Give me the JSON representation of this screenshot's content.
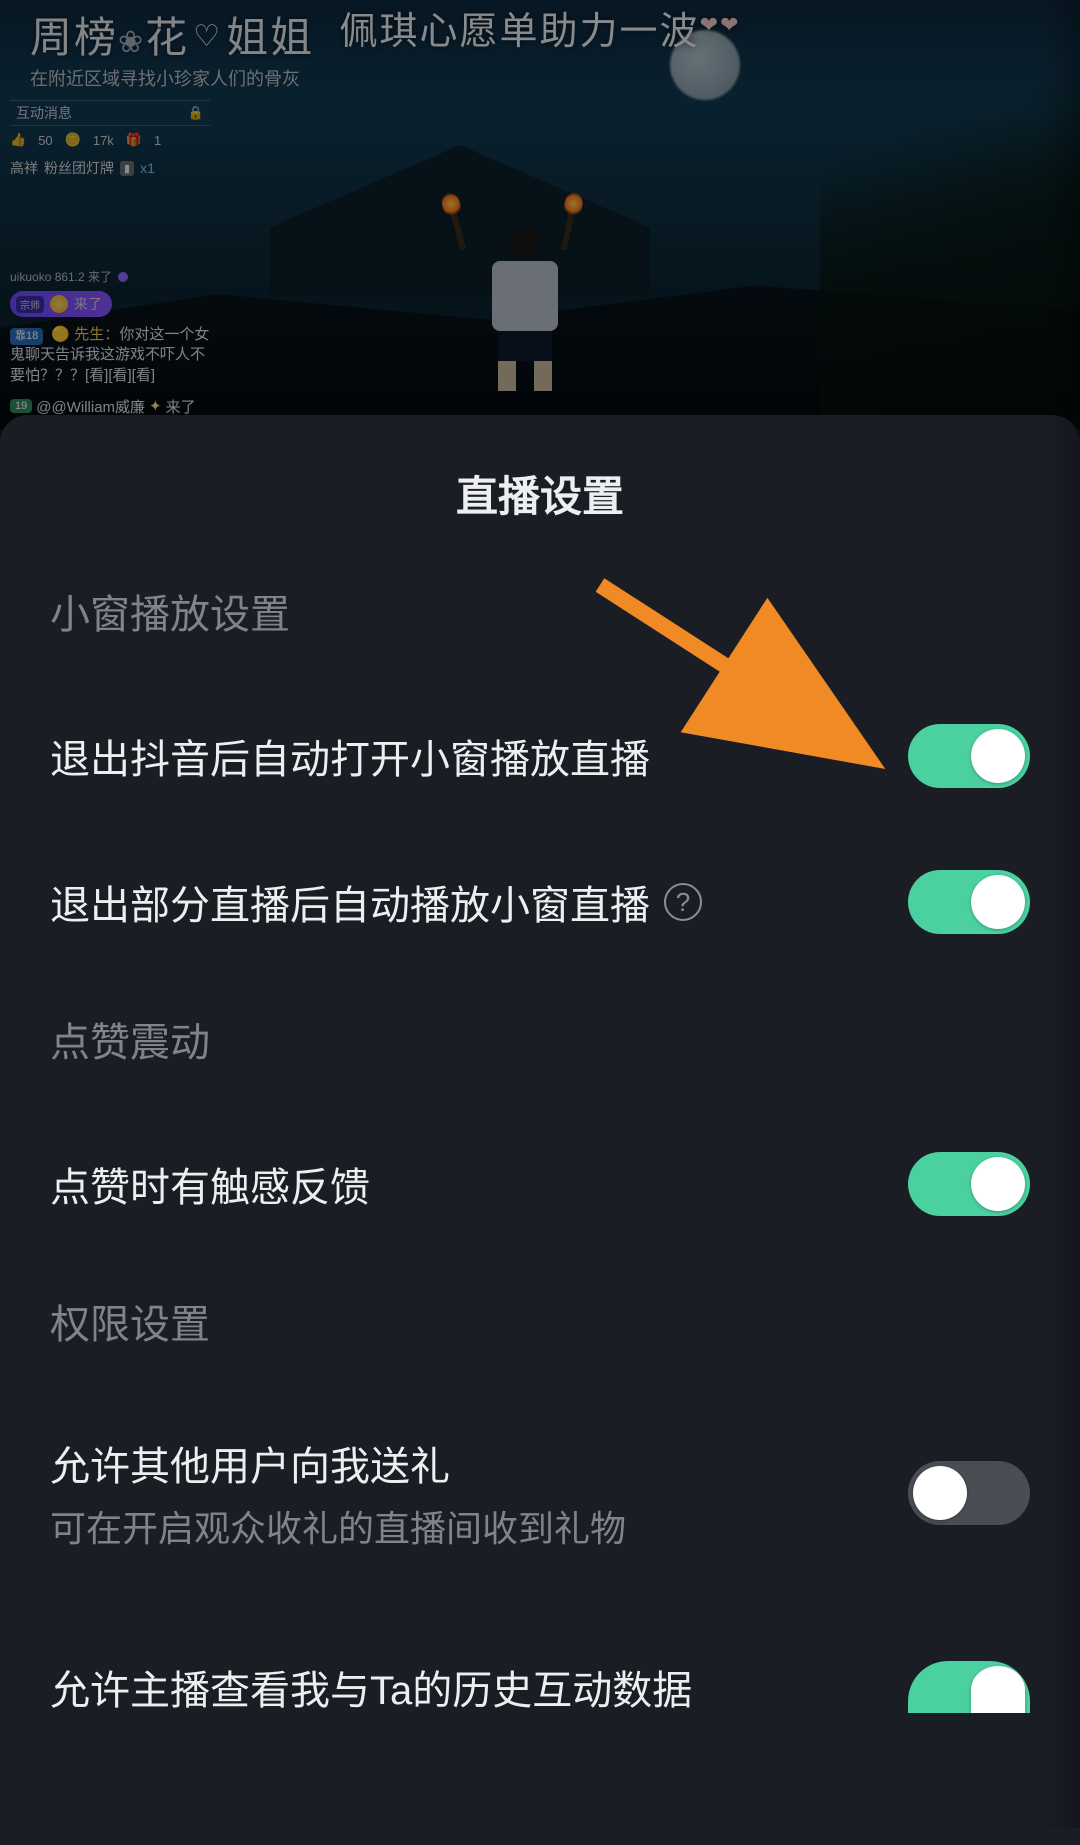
{
  "stream": {
    "top_left_title_a": "周榜",
    "top_left_title_b": "花",
    "top_left_title_c": "姐姐",
    "top_left_sub": "在附近区域寻找小珍家人们的骨灰",
    "banner": "佩琪心愿单助力一波",
    "chat_header": "互动消息",
    "stat_likes": "50",
    "stat_coins": "17k",
    "stat_gifts": "1",
    "fan_name": "高祥",
    "fan_badge": "粉丝团灯牌",
    "fan_x1": "x1",
    "small_label": "uikuoko 861.2 来了",
    "pill_level": "宗师",
    "pill_text": "来了",
    "msg_level": "靠18",
    "msg_who": "先生",
    "msg_body": "你对这一个女鬼聊天告诉我这游戏不吓人不要怕？？？[看][看][看]",
    "enter_level": "19",
    "enter_text": "@@William威廉",
    "enter_suffix": "来了"
  },
  "sheet": {
    "title": "直播设置",
    "sections": {
      "pip": "小窗播放设置",
      "like": "点赞震动",
      "perm": "权限设置"
    },
    "items": {
      "pip_exit_app": "退出抖音后自动打开小窗播放直播",
      "pip_exit_room": "退出部分直播后自动播放小窗直播",
      "like_haptic": "点赞时有触感反馈",
      "allow_gift_title": "允许其他用户向我送礼",
      "allow_gift_desc": "可在开启观众收礼的直播间收到礼物",
      "allow_history": "允许主播查看我与Ta的历史互动数据"
    },
    "states": {
      "pip_exit_app": true,
      "pip_exit_room": true,
      "like_haptic": true,
      "allow_gift": false,
      "allow_history": true
    }
  },
  "colors": {
    "toggle_on": "#4bd0a0",
    "toggle_off": "#4a4d54",
    "sheet_bg": "#1b1d25",
    "annotation": "#f08a24"
  }
}
